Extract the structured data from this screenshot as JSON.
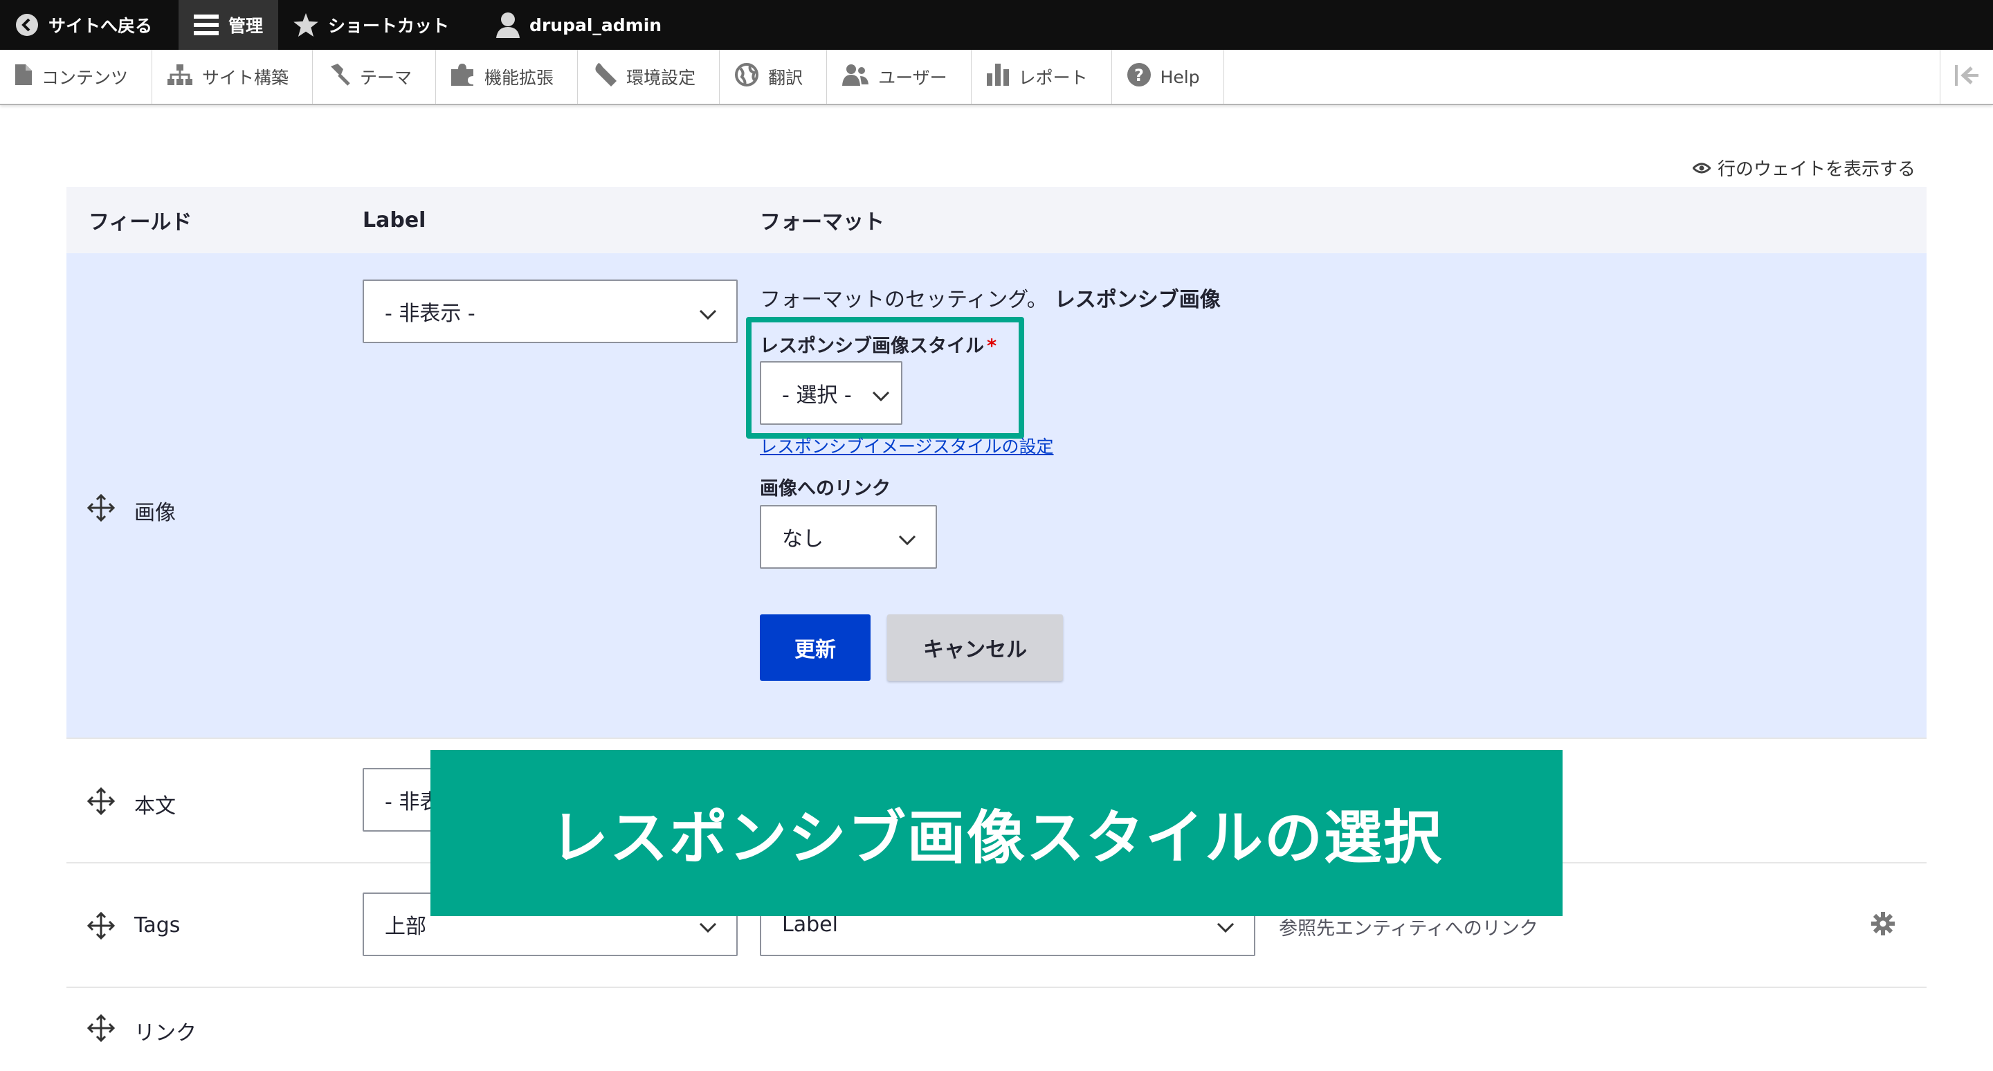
{
  "toolbar": {
    "back": "サイトへ戻る",
    "manage": "管理",
    "shortcuts": "ショートカット",
    "user": "drupal_admin"
  },
  "tray": {
    "items": [
      "コンテンツ",
      "サイト構築",
      "テーマ",
      "機能拡張",
      "環境設定",
      "翻訳",
      "ユーザー",
      "レポート",
      "Help"
    ]
  },
  "weights_toggle": "行のウェイトを表示する",
  "table": {
    "headers": {
      "field": "フィールド",
      "label": "Label",
      "format": "フォーマット"
    },
    "rows": {
      "image": {
        "name": "画像",
        "label_value": "- 非表示 -",
        "format_summary_prefix": "フォーマットのセッティング。",
        "format_summary_name": "レスポンシブ画像",
        "style_label": "レスポンシブ画像スタイル",
        "required_mark": "*",
        "style_value": "- 選択 -",
        "style_link": "レスポンシブイメージスタイルの設定",
        "link_label": "画像へのリンク",
        "link_value": "なし",
        "update_button": "更新",
        "cancel_button": "キャンセル"
      },
      "body": {
        "name": "本文",
        "label_value": "- 非表示 -"
      },
      "tags": {
        "name": "Tags",
        "label_value": "上部",
        "format_value": "Label",
        "summary": "参照先エンティティへのリンク"
      },
      "link": {
        "name": "リンク"
      }
    }
  },
  "banner": "レスポンシブ画像スタイルの選択",
  "colors": {
    "accent": "#00a68c",
    "primary": "#003ecc",
    "edit_row": "#e3ebff"
  }
}
